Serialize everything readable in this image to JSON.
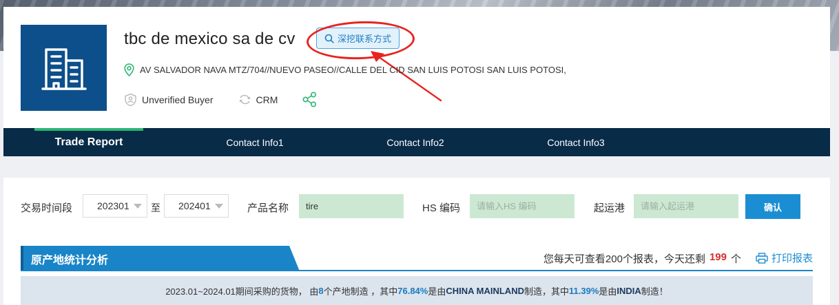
{
  "company": {
    "name": "tbc de mexico sa de cv",
    "mine_contact_label": "深挖联系方式",
    "address": "AV SALVADOR NAVA MTZ/704//NUEVO PASEO//CALLE DEL CID SAN LUIS POTOSI SAN LUIS POTOSI,",
    "verification_label": "Unverified Buyer",
    "crm_label": "CRM"
  },
  "tabs": [
    {
      "label": "Trade Report",
      "active": true
    },
    {
      "label": "Contact Info1",
      "active": false
    },
    {
      "label": "Contact Info2",
      "active": false
    },
    {
      "label": "Contact Info3",
      "active": false
    }
  ],
  "filters": {
    "date_label": "交易时间段",
    "date_from": "202301",
    "date_separator": "至",
    "date_to": "202401",
    "product_label": "产品名称",
    "product_value": "tire",
    "hs_label": "HS 编码",
    "hs_placeholder": "请输入HS 编码",
    "port_label": "起运港",
    "port_placeholder": "请输入起运港",
    "confirm_label": "确认"
  },
  "section": {
    "title": "原产地统计分析",
    "quota_prefix": "您每天可查看200个报表，今天还剩",
    "quota_remaining": "199",
    "quota_suffix": "个",
    "print_label": "打印报表"
  },
  "summary": {
    "part1": "2023.01~2024.01期间采购的货物， 由 ",
    "origin_count": "8",
    "part2": "个产地制造 ，其中",
    "pct1": "76.84%",
    "part3": "是由",
    "country1": "CHINA MAINLAND",
    "part4": "制造，其中",
    "pct2": "11.39%",
    "part5": "是由",
    "country2": "INDIA",
    "part6": "制造！"
  },
  "colors": {
    "logo_bg": "#0d4f8a",
    "tab_bar_bg": "#082b48",
    "tab_active_indicator": "#2bb673",
    "primary_blue": "#1b8ed3",
    "annotation_red": "#e8231f",
    "input_green": "#cce8d3"
  },
  "icons": [
    "building-icon",
    "search-icon",
    "location-pin-icon",
    "unverified-shield-icon",
    "crm-sync-icon",
    "share-icon",
    "printer-icon"
  ]
}
